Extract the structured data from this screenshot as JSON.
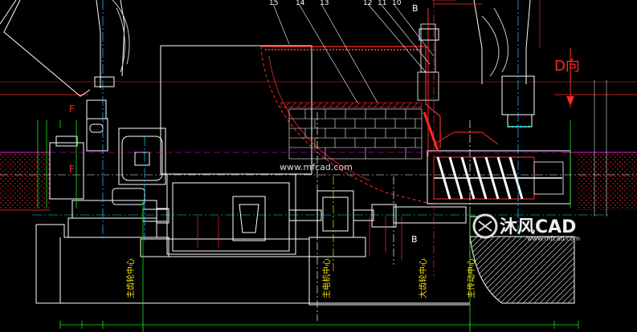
{
  "drawing": {
    "part_numbers": [
      "15",
      "14",
      "13",
      "12",
      "11",
      "10"
    ],
    "section_marks": {
      "top": "B",
      "bottom": "B"
    },
    "view_label": "D向",
    "centerline_labels": [
      "主齿轮中心",
      "主电机中心",
      "大齿轮中心",
      "主传动中心"
    ],
    "left_marks": [
      "F",
      "F"
    ]
  },
  "watermark": {
    "center_text": "www.mfcad.com",
    "logo_text": "沐风CAD",
    "logo_url": "www.mfcad.com"
  },
  "colors": {
    "background": "#000000",
    "line_white": "#ffffff",
    "line_red": "#ff2a2a",
    "line_green": "#19e619",
    "line_cyan": "#00e5ff",
    "line_magenta": "#e619e6",
    "line_yellow": "#ffe600"
  }
}
